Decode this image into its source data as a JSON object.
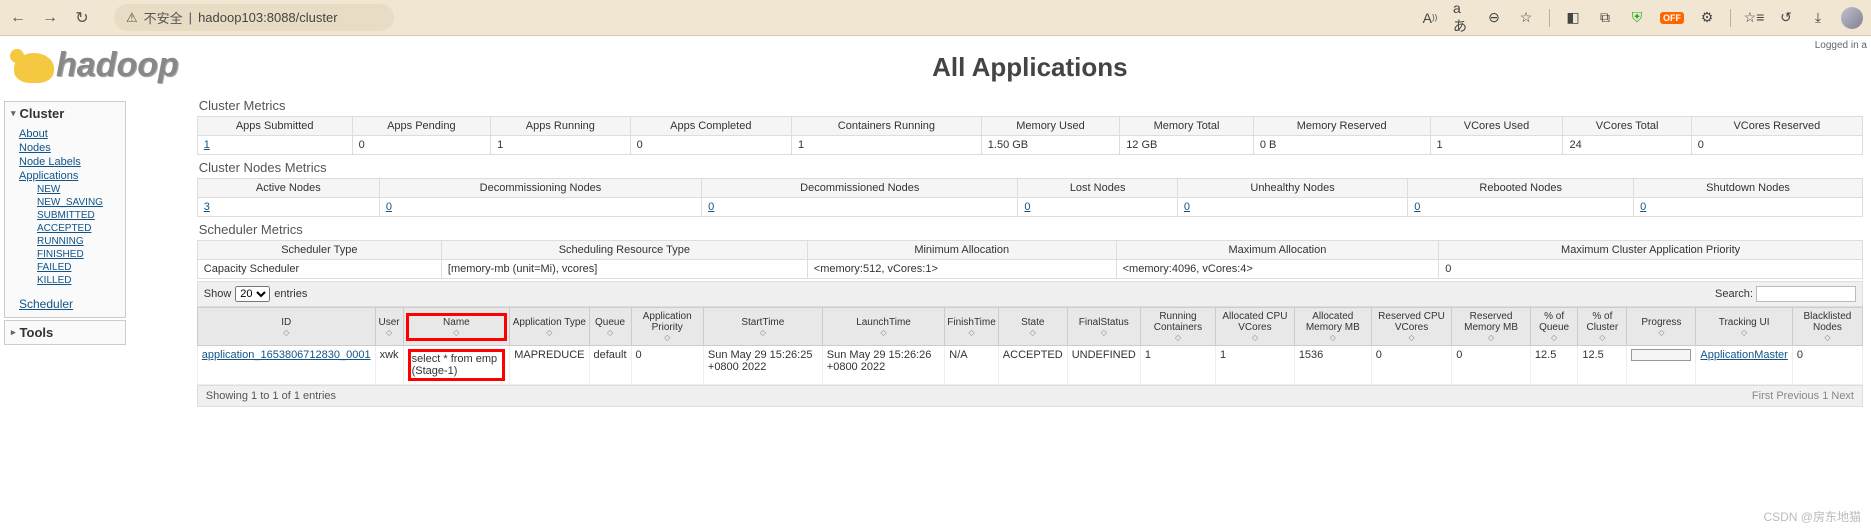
{
  "browser": {
    "insecure": "不安全",
    "sep": "|",
    "url": "hadoop103:8088/cluster",
    "badge": "OFF"
  },
  "header": {
    "logged": "Logged in a",
    "logo": "hadoop",
    "title": "All Applications"
  },
  "sidebar": {
    "cluster_hdr": "Cluster",
    "items": [
      "About",
      "Nodes",
      "Node Labels",
      "Applications"
    ],
    "apps_sub": [
      "NEW",
      "NEW_SAVING",
      "SUBMITTED",
      "ACCEPTED",
      "RUNNING",
      "FINISHED",
      "FAILED",
      "KILLED"
    ],
    "scheduler": "Scheduler",
    "tools_hdr": "Tools"
  },
  "cluster_metrics": {
    "hdr": "Cluster Metrics",
    "cols": [
      "Apps Submitted",
      "Apps Pending",
      "Apps Running",
      "Apps Completed",
      "Containers Running",
      "Memory Used",
      "Memory Total",
      "Memory Reserved",
      "VCores Used",
      "VCores Total",
      "VCores Reserved"
    ],
    "row": [
      "1",
      "0",
      "1",
      "0",
      "1",
      "1.50 GB",
      "12 GB",
      "0 B",
      "1",
      "24",
      "0"
    ]
  },
  "nodes_metrics": {
    "hdr": "Cluster Nodes Metrics",
    "cols": [
      "Active Nodes",
      "Decommissioning Nodes",
      "Decommissioned Nodes",
      "Lost Nodes",
      "Unhealthy Nodes",
      "Rebooted Nodes",
      "Shutdown Nodes"
    ],
    "row": [
      "3",
      "0",
      "0",
      "0",
      "0",
      "0",
      "0"
    ]
  },
  "sched_metrics": {
    "hdr": "Scheduler Metrics",
    "cols": [
      "Scheduler Type",
      "Scheduling Resource Type",
      "Minimum Allocation",
      "Maximum Allocation",
      "Maximum Cluster Application Priority"
    ],
    "row": [
      "Capacity Scheduler",
      "[memory-mb (unit=Mi), vcores]",
      "<memory:512, vCores:1>",
      "<memory:4096, vCores:4>",
      "0"
    ]
  },
  "datatable": {
    "show": "Show",
    "entries": "entries",
    "sel": "20",
    "search": "Search:",
    "footer": "Showing 1 to 1 of 1 entries",
    "pag": "First Previous 1 Next"
  },
  "apps": {
    "cols": [
      "ID",
      "User",
      "Name",
      "Application Type",
      "Queue",
      "Application Priority",
      "StartTime",
      "LaunchTime",
      "FinishTime",
      "State",
      "FinalStatus",
      "Running Containers",
      "Allocated CPU VCores",
      "Allocated Memory MB",
      "Reserved CPU VCores",
      "Reserved Memory MB",
      "% of Queue",
      "% of Cluster",
      "Progress",
      "Tracking UI",
      "Blacklisted Nodes"
    ],
    "row": {
      "id": "application_1653806712830_0001",
      "user": "xwk",
      "name": "select * from emp (Stage-1)",
      "type": "MAPREDUCE",
      "queue": "default",
      "priority": "0",
      "start": "Sun May 29 15:26:25 +0800 2022",
      "launch": "Sun May 29 15:26:26 +0800 2022",
      "finish": "N/A",
      "state": "ACCEPTED",
      "final": "UNDEFINED",
      "containers": "1",
      "cpu": "1",
      "mem": "1536",
      "rcpu": "0",
      "rmem": "0",
      "pq": "12.5",
      "pc": "12.5",
      "tracking": "ApplicationMaster",
      "bl": "0"
    }
  },
  "watermark": "CSDN @房东地猫"
}
